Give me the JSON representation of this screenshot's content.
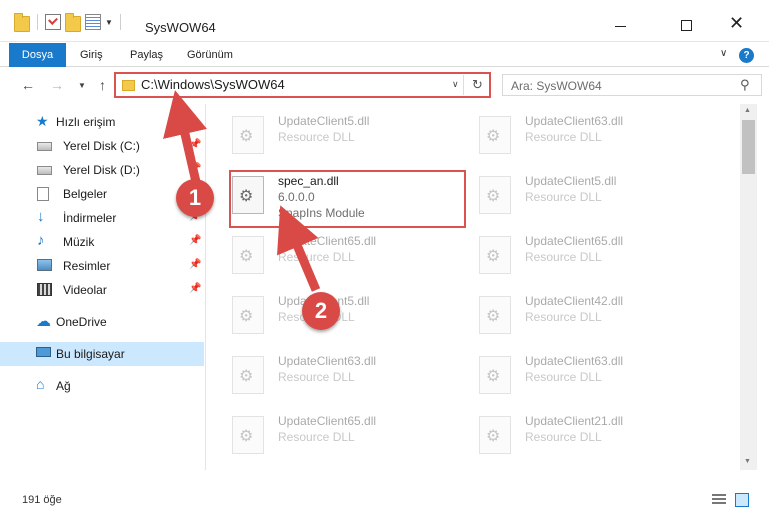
{
  "window": {
    "title": "SysWOW64"
  },
  "ribbon": {
    "tabs": [
      "Dosya",
      "Giriş",
      "Paylaş",
      "Görünüm"
    ],
    "help": "?"
  },
  "nav": {
    "address": "C:\\Windows\\SysWOW64",
    "search_placeholder": "Ara: SysWOW64"
  },
  "sidebar": {
    "items": [
      {
        "label": "Hızlı erişim",
        "icon": "star-icon"
      },
      {
        "label": "Yerel Disk (C:)",
        "icon": "disk-icon"
      },
      {
        "label": "Yerel Disk (D:)",
        "icon": "disk-icon"
      },
      {
        "label": "Belgeler",
        "icon": "documents-icon"
      },
      {
        "label": "İndirmeler",
        "icon": "downloads-icon"
      },
      {
        "label": "Müzik",
        "icon": "music-icon"
      },
      {
        "label": "Resimler",
        "icon": "pictures-icon"
      },
      {
        "label": "Videolar",
        "icon": "videos-icon"
      },
      {
        "label": "OneDrive",
        "icon": "onedrive-icon"
      },
      {
        "label": "Bu bilgisayar",
        "icon": "computer-icon"
      },
      {
        "label": "Ağ",
        "icon": "network-icon"
      }
    ]
  },
  "files": {
    "main": {
      "name": "spec_an.dll",
      "version": "6.0.0.0",
      "type": "SnapIns Module"
    },
    "left": [
      {
        "name": "UpdateClient5.dll",
        "type": "Resource DLL"
      },
      {
        "name": "UpdateClient65.dll",
        "type": "Resource DLL"
      },
      {
        "name": "UpdateClient5.dll",
        "type": "Resource DLL"
      },
      {
        "name": "UpdateClient63.dll",
        "type": "Resource DLL"
      },
      {
        "name": "UpdateClient65.dll",
        "type": "Resource DLL"
      }
    ],
    "right": [
      {
        "name": "UpdateClient63.dll",
        "type": "Resource DLL"
      },
      {
        "name": "UpdateClient5.dll",
        "type": "Resource DLL"
      },
      {
        "name": "UpdateClient65.dll",
        "type": "Resource DLL"
      },
      {
        "name": "UpdateClient42.dll",
        "type": "Resource DLL"
      },
      {
        "name": "UpdateClient63.dll",
        "type": "Resource DLL"
      },
      {
        "name": "UpdateClient21.dll",
        "type": "Resource DLL"
      }
    ]
  },
  "status": {
    "count": "191 öğe"
  },
  "annotations": {
    "step1": "1",
    "step2": "2",
    "color": "#d94a47"
  }
}
